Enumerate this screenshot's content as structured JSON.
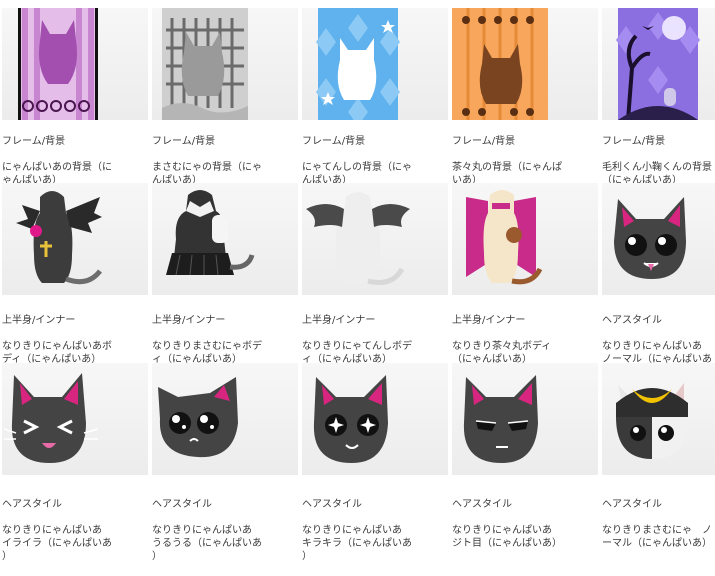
{
  "items": [
    {
      "icon": "frame-background-icon",
      "category": "フレーム/背景",
      "name": "にゃんぱいあの背景（に\nゃんぱいあ）",
      "colors": {
        "bg": "#c77fd0",
        "accent": "#8d3b96"
      }
    },
    {
      "icon": "frame-background-icon",
      "category": "フレーム/背景",
      "name": "まさむにゃの背景（にゃ\nんぱいあ）",
      "colors": {
        "bg": "#8a8a8a",
        "accent": "#3a3a3a"
      }
    },
    {
      "icon": "frame-background-icon",
      "category": "フレーム/背景",
      "name": "にゃてんしの背景（にゃ\nんぱいあ）",
      "colors": {
        "bg": "#4ea5e8",
        "accent": "#ffffff"
      }
    },
    {
      "icon": "frame-background-icon",
      "category": "フレーム/背景",
      "name": "茶々丸の背景（にゃんぱ\nいあ）",
      "colors": {
        "bg": "#f29a47",
        "accent": "#6b3b1a"
      }
    },
    {
      "icon": "frame-background-icon",
      "category": "フレーム/背景",
      "name": "毛利くん小鞠くんの背景\n（にゃんぱいあ）",
      "colors": {
        "bg": "#7f5bd1",
        "accent": "#2a1a4a"
      }
    },
    {
      "icon": "body-top-icon",
      "category": "上半身/インナー",
      "name": "なりきりにゃんぱいあボ\nディ（にゃんぱいあ）",
      "colors": {
        "bg": "#3c3c3c",
        "accent": "#e0198a"
      }
    },
    {
      "icon": "body-top-icon",
      "category": "上半身/インナー",
      "name": "なりきりまさむにゃボデ\nィ（にゃんぱいあ）",
      "colors": {
        "bg": "#3a3a3a",
        "accent": "#eeeeee"
      }
    },
    {
      "icon": "body-top-icon",
      "category": "上半身/インナー",
      "name": "なりきりにゃてんしボデ\nィ（にゃんぱいあ）",
      "colors": {
        "bg": "#e8e8e8",
        "accent": "#555555"
      }
    },
    {
      "icon": "body-top-icon",
      "category": "上半身/インナー",
      "name": "なりきり茶々丸ボディ\n（にゃんぱいあ）",
      "colors": {
        "bg": "#f5e3c7",
        "accent": "#c92b8a"
      }
    },
    {
      "icon": "hairstyle-icon",
      "category": "ヘアスタイル",
      "name": "なりきりにゃんぱいあ\nノーマル（にゃんぱいあ\n）",
      "colors": {
        "bg": "#444444",
        "accent": "#d8257f"
      }
    },
    {
      "icon": "hairstyle-icon",
      "category": "ヘアスタイル",
      "name": "なりきりにゃんぱいあ\nイライラ（にゃんぱいあ\n）",
      "colors": {
        "bg": "#444444",
        "accent": "#d8257f"
      }
    },
    {
      "icon": "hairstyle-icon",
      "category": "ヘアスタイル",
      "name": "なりきりにゃんぱいあ\nうるうる（にゃんぱいあ\n）",
      "colors": {
        "bg": "#444444",
        "accent": "#d8257f"
      }
    },
    {
      "icon": "hairstyle-icon",
      "category": "ヘアスタイル",
      "name": "なりきりにゃんぱいあ\nキラキラ（にゃんぱいあ\n）",
      "colors": {
        "bg": "#444444",
        "accent": "#d8257f"
      }
    },
    {
      "icon": "hairstyle-icon",
      "category": "ヘアスタイル",
      "name": "なりきりにゃんぱいあ\nジト目（にゃんぱいあ）",
      "colors": {
        "bg": "#444444",
        "accent": "#d8257f"
      }
    },
    {
      "icon": "hairstyle-icon",
      "category": "ヘアスタイル",
      "name": "なりきりまさむにゃ　ノ\nーマル（にゃんぱいあ）",
      "colors": {
        "bg": "#3a3a3a",
        "accent": "#f0c200"
      }
    }
  ]
}
